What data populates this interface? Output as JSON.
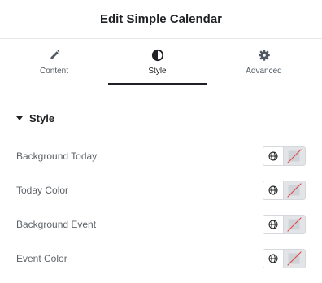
{
  "header": {
    "title": "Edit Simple Calendar"
  },
  "tabs": [
    {
      "label": "Content",
      "icon": "pencil-icon"
    },
    {
      "label": "Style",
      "icon": "contrast-icon",
      "active": true
    },
    {
      "label": "Advanced",
      "icon": "gear-icon"
    }
  ],
  "section": {
    "title": "Style",
    "icon": "caret-down-icon"
  },
  "controls": [
    {
      "label": "Background Today"
    },
    {
      "label": "Today Color"
    },
    {
      "label": "Background Event"
    },
    {
      "label": "Event Color"
    }
  ],
  "colors": {
    "accent": "#1f2124",
    "divider": "#e6e8ea",
    "swatch_empty": "#e2e4e7",
    "slash": "#e34a4a"
  }
}
